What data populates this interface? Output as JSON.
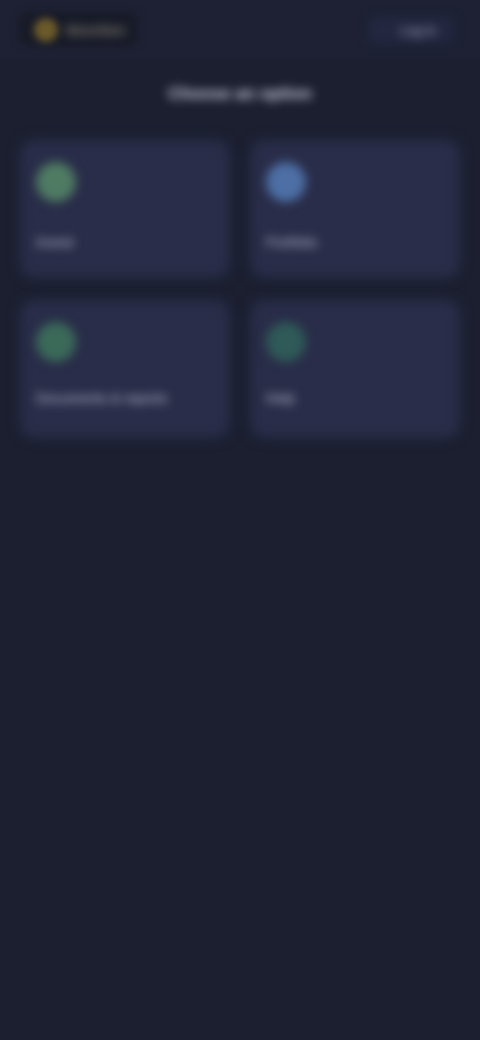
{
  "app": {
    "name": "Moonfare",
    "header_action": "Log in"
  },
  "page": {
    "title": "Choose an option"
  },
  "tiles": [
    {
      "label": "Invest",
      "icon": "chart-icon",
      "color": "#4f7b63"
    },
    {
      "label": "Portfolio",
      "icon": "user-icon",
      "color": "#4d6fa5"
    },
    {
      "label": "Documents & reports",
      "icon": "document-icon",
      "color": "#3b6a59"
    },
    {
      "label": "Help",
      "icon": "help-icon",
      "color": "#2f5a58"
    }
  ],
  "colors": {
    "background": "#1b1f30",
    "tile": "#292d49",
    "brand_accent": "#6b5a2a"
  }
}
